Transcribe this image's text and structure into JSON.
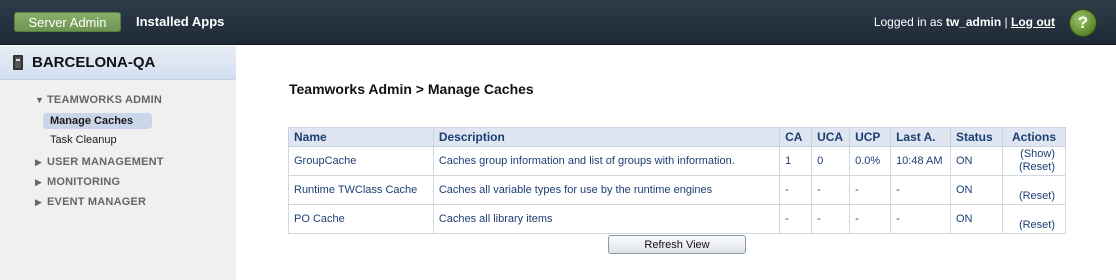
{
  "topbar": {
    "tabs": [
      {
        "label": "Server Admin",
        "active": true
      },
      {
        "label": "Installed Apps",
        "active": false
      }
    ],
    "login_prefix": "Logged in as ",
    "username": "tw_admin",
    "separator": " | ",
    "logout_label": "Log out",
    "help_glyph": "?"
  },
  "sidebar": {
    "server_name": "BARCELONA-QA",
    "sections": [
      {
        "label": "TEAMWORKS ADMIN",
        "expanded": true,
        "items": [
          "Manage Caches",
          "Task Cleanup"
        ]
      },
      {
        "label": "USER MANAGEMENT",
        "expanded": false
      },
      {
        "label": "MONITORING",
        "expanded": false
      },
      {
        "label": "EVENT MANAGER",
        "expanded": false
      }
    ],
    "expanded_glyph": "▼",
    "collapsed_glyph": "▶"
  },
  "main": {
    "title": "Teamworks Admin > Manage Caches",
    "table": {
      "columns": [
        "Name",
        "Description",
        "CA",
        "UCA",
        "UCP",
        "Last A.",
        "Status",
        "Actions"
      ],
      "rows": [
        {
          "name": "GroupCache",
          "description": "Caches group information and list of groups with information.",
          "ca": "1",
          "uca": "0",
          "ucp": "0.0%",
          "last": "10:48 AM",
          "status": "ON",
          "show": "(Show)",
          "reset": "(Reset)"
        },
        {
          "name": "Runtime TWClass Cache",
          "description": "Caches all variable types for use by the runtime engines",
          "ca": "-",
          "uca": "-",
          "ucp": "-",
          "last": "-",
          "status": "ON",
          "show": "",
          "reset": "(Reset)"
        },
        {
          "name": "PO Cache",
          "description": "Caches all library items",
          "ca": "-",
          "uca": "-",
          "ucp": "-",
          "last": "-",
          "status": "ON",
          "show": "",
          "reset": "(Reset)"
        }
      ]
    },
    "refresh_label": "Refresh View"
  }
}
